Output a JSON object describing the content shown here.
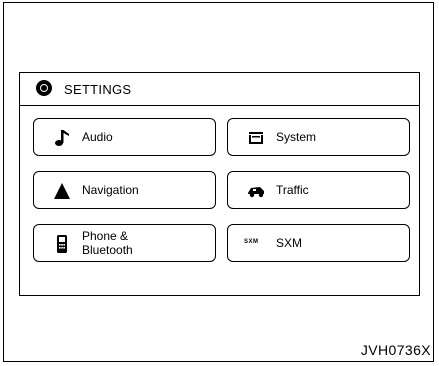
{
  "screen": {
    "title": "SETTINGS",
    "buttons": [
      {
        "label": "Audio",
        "icon": "music-note-icon"
      },
      {
        "label": "System",
        "icon": "system-icon"
      },
      {
        "label": "Navigation",
        "icon": "navigation-arrow-icon"
      },
      {
        "label": "Traffic",
        "icon": "traffic-car-icon"
      },
      {
        "label": "Phone &",
        "label2": "Bluetooth",
        "icon": "phone-icon"
      },
      {
        "label": "SXM",
        "icon": "sxm-icon",
        "icon_text": "SXM"
      }
    ]
  },
  "figure_id": "JVH0736X"
}
